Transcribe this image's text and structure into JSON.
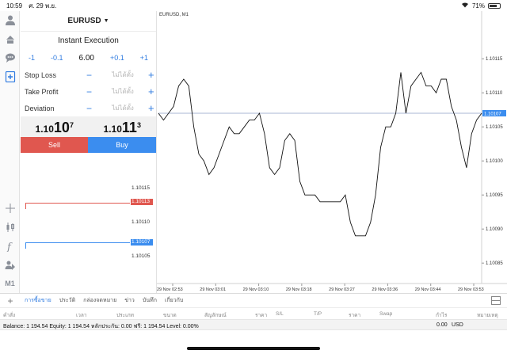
{
  "status_bar": {
    "time": "10:59",
    "date": "ศ. 29 พ.ย.",
    "battery": "71%"
  },
  "toolbar": {
    "account_label": "M1"
  },
  "trade_panel": {
    "symbol": "EURUSD",
    "execution_type": "Instant Execution",
    "volume": {
      "minus1": "-1",
      "minus01": "-0.1",
      "value": "6.00",
      "plus01": "+0.1",
      "plus1": "+1"
    },
    "params": [
      {
        "label": "Stop Loss",
        "value": "ไม่ได้ตั้ง"
      },
      {
        "label": "Take Profit",
        "value": "ไม่ได้ตั้ง"
      },
      {
        "label": "Deviation",
        "value": "ไม่ได้ตั้ง"
      }
    ],
    "bid": {
      "main": "1.10",
      "big": "10",
      "sup": "7"
    },
    "ask": {
      "main": "1.10",
      "big": "11",
      "sup": "3"
    },
    "sell_label": "Sell",
    "buy_label": "Buy"
  },
  "depth": {
    "levels": [
      "1.10115",
      "1.10110",
      "1.10105"
    ],
    "sell_price": "1.10113",
    "buy_price": "1.10107"
  },
  "chart_data": {
    "type": "line",
    "title": "EURUSD, M1",
    "y_ticks": [
      "1.10115",
      "1.10110",
      "1.10105",
      "1.10100",
      "1.10095",
      "1.10090",
      "1.10085"
    ],
    "ylim": [
      1.10082,
      1.10122
    ],
    "current_price": "1.10107",
    "current_value": 1.10107,
    "x_ticks": [
      "29 Nov 02:53",
      "29 Nov 03:01",
      "29 Nov 03:10",
      "29 Nov 03:18",
      "29 Nov 03:27",
      "29 Nov 03:36",
      "29 Nov 03:44",
      "29 Nov 03:53"
    ],
    "x": [
      "02:50",
      "02:51",
      "02:52",
      "02:53",
      "02:54",
      "02:55",
      "02:56",
      "02:57",
      "02:58",
      "02:59",
      "03:00",
      "03:01",
      "03:02",
      "03:03",
      "03:04",
      "03:05",
      "03:06",
      "03:07",
      "03:08",
      "03:09",
      "03:10",
      "03:11",
      "03:12",
      "03:13",
      "03:14",
      "03:15",
      "03:16",
      "03:17",
      "03:18",
      "03:19",
      "03:20",
      "03:21",
      "03:22",
      "03:23",
      "03:24",
      "03:25",
      "03:26",
      "03:27",
      "03:28",
      "03:29",
      "03:30",
      "03:31",
      "03:32",
      "03:33",
      "03:34",
      "03:35",
      "03:36",
      "03:37",
      "03:38",
      "03:39",
      "03:40",
      "03:41",
      "03:42",
      "03:43",
      "03:44",
      "03:45",
      "03:46",
      "03:47",
      "03:48",
      "03:49",
      "03:50",
      "03:51",
      "03:52",
      "03:53",
      "03:54"
    ],
    "y": [
      1.10107,
      1.10106,
      1.10107,
      1.10108,
      1.10111,
      1.10112,
      1.10111,
      1.10105,
      1.10101,
      1.101,
      1.10098,
      1.10099,
      1.10101,
      1.10103,
      1.10105,
      1.10104,
      1.10104,
      1.10105,
      1.10106,
      1.10106,
      1.10107,
      1.10104,
      1.10099,
      1.10098,
      1.10099,
      1.10103,
      1.10104,
      1.10103,
      1.10097,
      1.10095,
      1.10095,
      1.10095,
      1.10094,
      1.10094,
      1.10094,
      1.10094,
      1.10094,
      1.10095,
      1.10091,
      1.10089,
      1.10089,
      1.10089,
      1.10091,
      1.10095,
      1.10102,
      1.10105,
      1.10105,
      1.10107,
      1.10113,
      1.10107,
      1.10111,
      1.10112,
      1.10113,
      1.10111,
      1.10111,
      1.1011,
      1.10112,
      1.10112,
      1.10108,
      1.10106,
      1.10102,
      1.10099,
      1.10104,
      1.10106,
      1.10107
    ]
  },
  "bottom_tabs": [
    "การซื้อขาย",
    "ประวัติ",
    "กล่องจดหมาย",
    "ข่าว",
    "บันทึก",
    "เกี่ยวกับ"
  ],
  "table_headers": [
    "คำสั่ง",
    "เวลา",
    "ประเภท",
    "ขนาด",
    "สัญลักษณ์",
    "ราคา",
    "S/L",
    "T/P",
    "ราคา",
    "Swap",
    "กำไร",
    "หมายเหตุ"
  ],
  "balance": {
    "text": "Balance: 1 194.54 Equity: 1 194.54 หลักประกัน: 0.00 ฟรี: 1 194.54 Level: 0.00%",
    "profit": "0.00",
    "currency": "USD"
  },
  "colors": {
    "sell": "#e0574f",
    "buy": "#3b8def",
    "accent": "#2f7be0",
    "price_line": "#8c9fc7"
  }
}
